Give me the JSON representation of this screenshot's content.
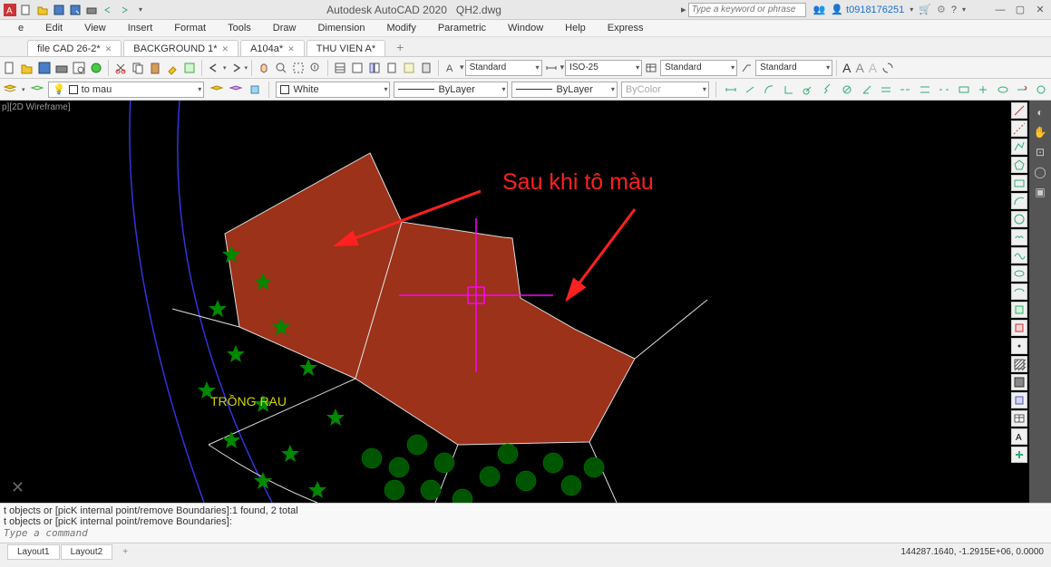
{
  "app": {
    "title": "Autodesk AutoCAD 2020",
    "filename": "QH2.dwg"
  },
  "search": {
    "placeholder": "Type a keyword or phrase"
  },
  "user": {
    "name": "t0918176251"
  },
  "menu": [
    "e",
    "Edit",
    "View",
    "Insert",
    "Format",
    "Tools",
    "Draw",
    "Dimension",
    "Modify",
    "Parametric",
    "Window",
    "Help",
    "Express"
  ],
  "tabs": [
    {
      "label": "file CAD 26-2*"
    },
    {
      "label": "BACKGROUND 1*"
    },
    {
      "label": "A104a*"
    },
    {
      "label": "THU VIEN A*"
    }
  ],
  "style_dropdowns": {
    "textstyle": "Standard",
    "dimstyle": "ISO-25",
    "tablestyle": "Standard",
    "mleaderstyle": "Standard"
  },
  "aaa": {
    "a1": "A",
    "a2": "A",
    "a3": "A"
  },
  "props": {
    "layer": "to mau",
    "color": "White",
    "linetype": "ByLayer",
    "lineweight": "ByLayer",
    "plotstyle": "ByColor"
  },
  "visualstyle": "p][2D Wireframe]",
  "annotation": "Sau khi tô màu",
  "drawing_text": "TRỒNG RAU",
  "cmd": {
    "line1": "t objects or [picK internal point/remove Boundaries]:1 found, 2 total",
    "line2": "t objects or [picK internal point/remove Boundaries]:",
    "placeholder": "Type a command"
  },
  "layout_tabs": [
    "Layout1",
    "Layout2"
  ],
  "coords": "144287.1640, -1.2915E+06, 0.0000"
}
